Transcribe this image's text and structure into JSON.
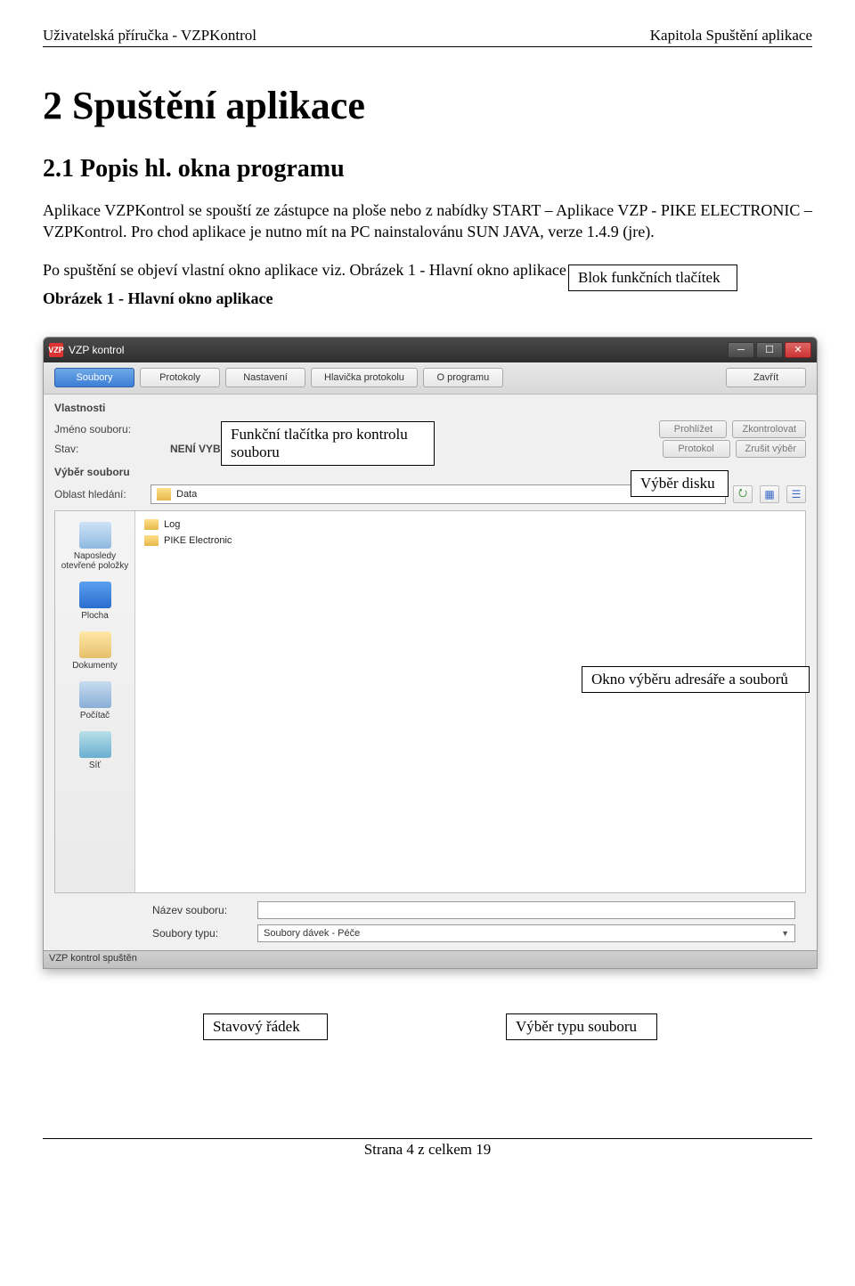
{
  "header": {
    "left": "Uživatelská příručka - VZPKontrol",
    "right": "Kapitola Spuštění aplikace"
  },
  "h1": "2  Spuštění aplikace",
  "h2": "2.1  Popis hl. okna programu",
  "paragraph": "Aplikace VZPKontrol se spouští ze zástupce na ploše nebo z nabídky START – Aplikace VZP - PIKE ELECTRONIC – VZPKontrol. Pro chod aplikace je nutno mít na PC nainstalovánu SUN JAVA, verze 1.4.9 (jre).",
  "paragraph2": "Po spuštění se objeví vlastní okno aplikace viz. Obrázek 1 - Hlavní okno aplikace",
  "caption": "Obrázek 1 - Hlavní okno aplikace",
  "callouts": {
    "blok": "Blok funkčních tlačítek",
    "funkcni": "Funkční tlačítka pro kontrolu souboru",
    "vyber_disku": "Výběr disku",
    "okno_vyberu": "Okno výběru adresáře a souborů",
    "stavovy": "Stavový řádek",
    "vyber_typu": "Výběr typu souboru"
  },
  "app": {
    "icon_text": "VZP",
    "title": "VZP kontrol",
    "toolbar": {
      "soubory": "Soubory",
      "protokoly": "Protokoly",
      "nastaveni": "Nastavení",
      "hlavicka": "Hlavička protokolu",
      "oprogramu": "O programu",
      "zavrit": "Zavřít"
    },
    "props": {
      "title": "Vlastnosti",
      "jmeno_label": "Jméno souboru:",
      "jmeno_value": "",
      "stav_label": "Stav:",
      "stav_value": "NENÍ VYBRÁN SOUBOR",
      "btn_prohlizet": "Prohlížet",
      "btn_zkontrolovat": "Zkontrolovat",
      "btn_protokol": "Protokol",
      "btn_zrusit": "Zrušit výběr"
    },
    "vyber": {
      "title": "Výběr souboru",
      "oblast_label": "Oblast hledání:",
      "oblast_value": "Data"
    },
    "places": {
      "recent": "Naposledy otevřené položky",
      "desktop": "Plocha",
      "docs": "Dokumenty",
      "pc": "Počítač",
      "net": "Síť"
    },
    "files": {
      "log": "Log",
      "pike": "PIKE Electronic"
    },
    "bottom": {
      "nazev_label": "Název souboru:",
      "nazev_value": "",
      "typ_label": "Soubory typu:",
      "typ_value": "Soubory dávek - Péče"
    },
    "status": "VZP kontrol spuštěn"
  },
  "footer": "Strana 4 z celkem 19"
}
